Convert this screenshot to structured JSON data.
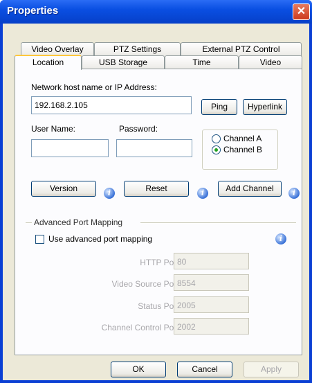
{
  "window": {
    "title": "Properties"
  },
  "tabs": {
    "row1": [
      "Video Overlay",
      "PTZ Settings",
      "External PTZ Control"
    ],
    "row2": [
      "Location",
      "USB Storage",
      "Time",
      "Video"
    ]
  },
  "form": {
    "host_label": "Network host name or IP Address:",
    "host_value": "192.168.2.105",
    "ping_label": "Ping",
    "hyperlink_label": "Hyperlink",
    "username_label": "User Name:",
    "username_value": "",
    "password_label": "Password:",
    "password_value": "",
    "channel_a_label": "Channel A",
    "channel_b_label": "Channel B",
    "channel_selected": "Channel B",
    "version_label": "Version",
    "reset_label": "Reset",
    "add_channel_label": "Add Channel"
  },
  "advanced": {
    "group_label": "Advanced Port Mapping",
    "checkbox_label": "Use advanced port mapping",
    "checked": false,
    "ports": [
      {
        "label": "HTTP Port:",
        "value": "80"
      },
      {
        "label": "Video Source Port:",
        "value": "8554"
      },
      {
        "label": "Status Port:",
        "value": "2005"
      },
      {
        "label": "Channel Control Port:",
        "value": "2002"
      }
    ]
  },
  "footer": {
    "ok_label": "OK",
    "cancel_label": "Cancel",
    "apply_label": "Apply"
  },
  "colors": {
    "titlebar": "#0a4fe2",
    "face": "#ece9d8",
    "close": "#cc3a1c",
    "tab_highlight": "#ffc73c"
  }
}
